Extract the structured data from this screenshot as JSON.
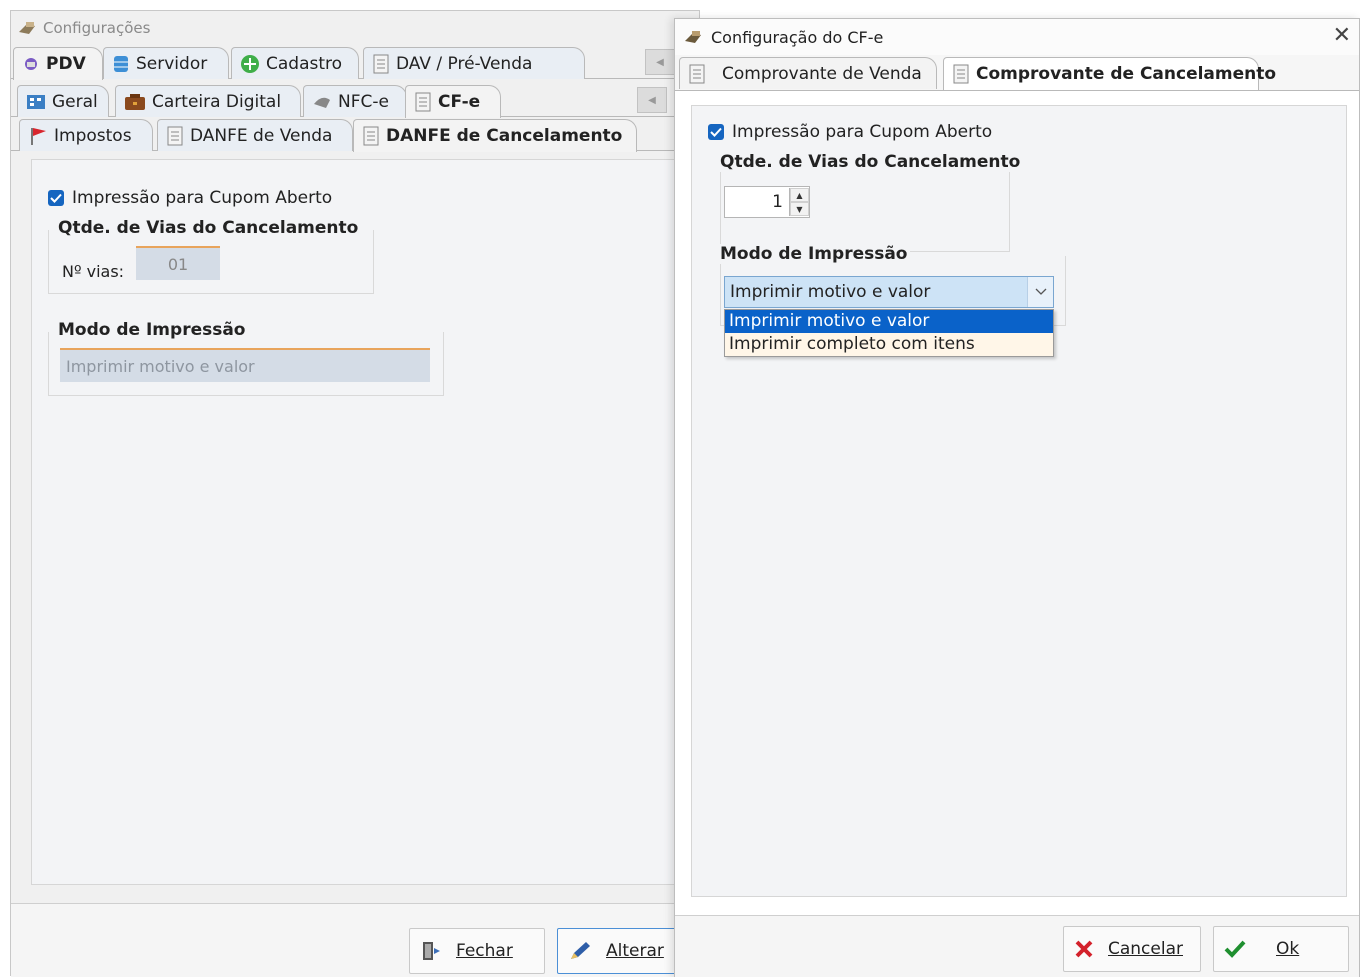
{
  "left_window": {
    "title": "Configurações",
    "tabs_row1": [
      {
        "label": "PDV",
        "icon": "pdv-icon",
        "active": true
      },
      {
        "label": "Servidor",
        "icon": "database-icon"
      },
      {
        "label": "Cadastro",
        "icon": "plus-circle-icon"
      },
      {
        "label": "DAV / Pré-Venda",
        "icon": "document-icon"
      }
    ],
    "tabs_row2": [
      {
        "label": "Geral",
        "icon": "calculator-icon"
      },
      {
        "label": "Carteira Digital",
        "icon": "wallet-icon"
      },
      {
        "label": "NFC-e",
        "icon": "nfce-icon"
      },
      {
        "label": "CF-e",
        "icon": "document-icon",
        "active": true
      }
    ],
    "tabs_row3": [
      {
        "label": "Impostos",
        "icon": "flag-icon"
      },
      {
        "label": "DANFE de Venda",
        "icon": "document-icon"
      },
      {
        "label": "DANFE de Cancelamento",
        "icon": "document-icon",
        "active": true
      }
    ],
    "checkbox_label": "Impressão para Cupom Aberto",
    "vias_group_title": "Qtde. de Vias do Cancelamento",
    "vias_label": "Nº vias:",
    "vias_value": "01",
    "modo_group_title": "Modo de Impressão",
    "modo_value": "Imprimir motivo e valor",
    "buttons": {
      "fechar": "Fechar",
      "alterar": "Alterar"
    }
  },
  "right_window": {
    "title": "Configuração do CF-e",
    "tabs": [
      {
        "label": "Comprovante de Venda",
        "icon": "document-icon"
      },
      {
        "label": "Comprovante de Cancelamento",
        "icon": "document-icon",
        "active": true
      }
    ],
    "checkbox_label": "Impressão para Cupom Aberto",
    "vias_group_title": "Qtde. de Vias do Cancelamento",
    "vias_value": "1",
    "modo_group_title": "Modo de Impressão",
    "combo_value": "Imprimir motivo e valor",
    "dropdown_options": [
      "Imprimir motivo e valor",
      "Imprimir completo com itens"
    ],
    "buttons": {
      "cancelar": "Cancelar",
      "ok": "Ok"
    }
  },
  "colors": {
    "accent": "#1565c0",
    "selection": "#0a62c9",
    "combo_bg": "#cde3f6",
    "orange_line": "#f0a050"
  }
}
